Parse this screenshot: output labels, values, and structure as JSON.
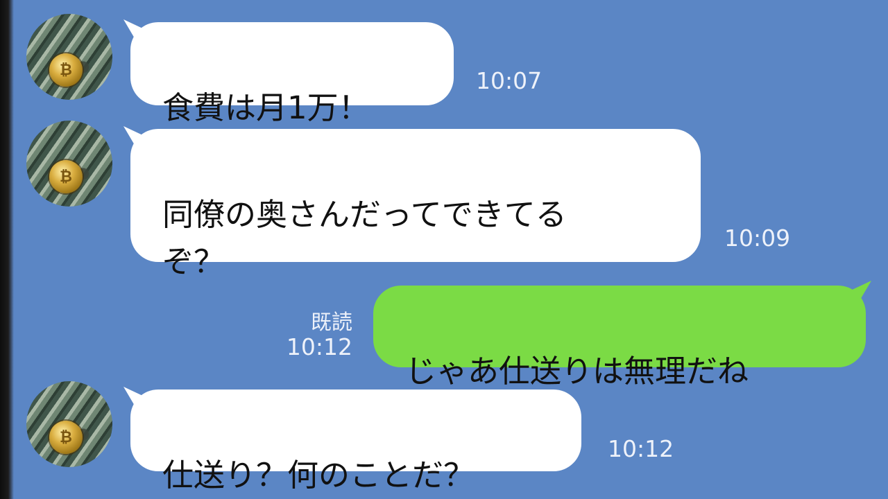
{
  "messages": [
    {
      "side": "in",
      "text": "食費は月1万！",
      "time": "10:07"
    },
    {
      "side": "in",
      "text": "同僚の奥さんだってできてる\nぞ？",
      "time": "10:09"
    },
    {
      "side": "out",
      "text": "じゃあ仕送りは無理だね",
      "time": "10:12",
      "status": "既読"
    },
    {
      "side": "in",
      "text": "仕送り？何のことだ？",
      "time": "10:12"
    }
  ],
  "avatar": {
    "icon": "bitcoin-coin-icon",
    "coin_glyph": "₿"
  },
  "colors": {
    "background": "#5b86c5",
    "incoming": "#ffffff",
    "outgoing": "#7bdb45"
  }
}
